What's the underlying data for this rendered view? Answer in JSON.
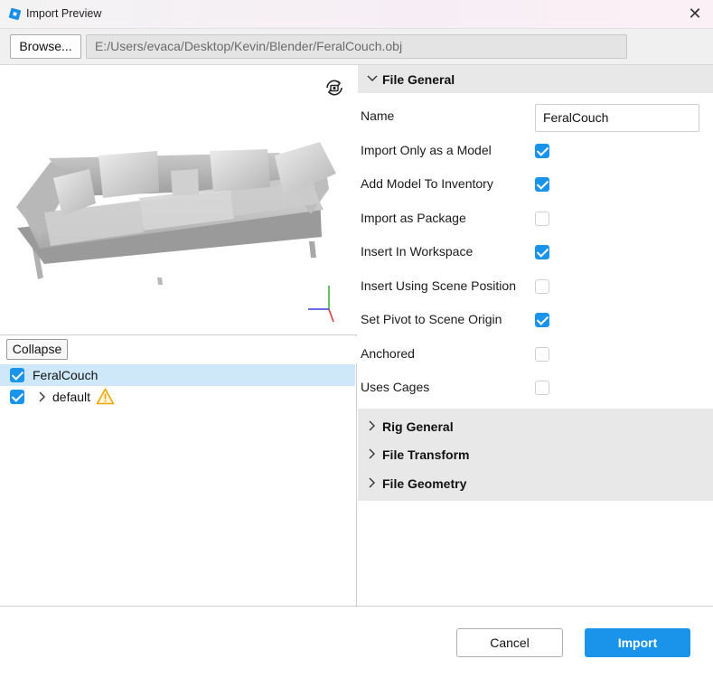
{
  "window": {
    "title": "Import Preview",
    "close_icon": "close-icon",
    "app_icon": "roblox-studio-icon"
  },
  "toolbar": {
    "browse_label": "Browse...",
    "file_path": "E:/Users/evaca/Desktop/Kevin/Blender/FeralCouch.obj"
  },
  "viewport": {
    "camera_icon": "camera-rotate-icon",
    "axis_icon": "axis-gizmo-icon",
    "axis_colors": {
      "x": "#e03a3a",
      "y": "#3ab93a",
      "z": "#3a3ae0"
    }
  },
  "tree": {
    "collapse_label": "Collapse",
    "items": [
      {
        "label": "FeralCouch",
        "checked": true,
        "selected": true
      },
      {
        "label": "default",
        "checked": true,
        "expandable": true,
        "warning": true
      }
    ]
  },
  "file_general": {
    "title": "File General",
    "name_label": "Name",
    "name_value": "FeralCouch",
    "options": [
      {
        "label": "Import Only as a Model",
        "checked": true
      },
      {
        "label": "Add Model To Inventory",
        "checked": true
      },
      {
        "label": "Import as Package",
        "checked": false
      },
      {
        "label": "Insert In Workspace",
        "checked": true
      },
      {
        "label": "Insert Using Scene Position",
        "checked": false
      },
      {
        "label": "Set Pivot to Scene Origin",
        "checked": true
      },
      {
        "label": "Anchored",
        "checked": false
      },
      {
        "label": "Uses Cages",
        "checked": false
      }
    ]
  },
  "collapsed_sections": [
    {
      "title": "Rig General"
    },
    {
      "title": "File Transform"
    },
    {
      "title": "File Geometry"
    }
  ],
  "footer": {
    "cancel_label": "Cancel",
    "import_label": "Import"
  },
  "colors": {
    "accent": "#1a93ea",
    "warning": "#f0a500"
  }
}
